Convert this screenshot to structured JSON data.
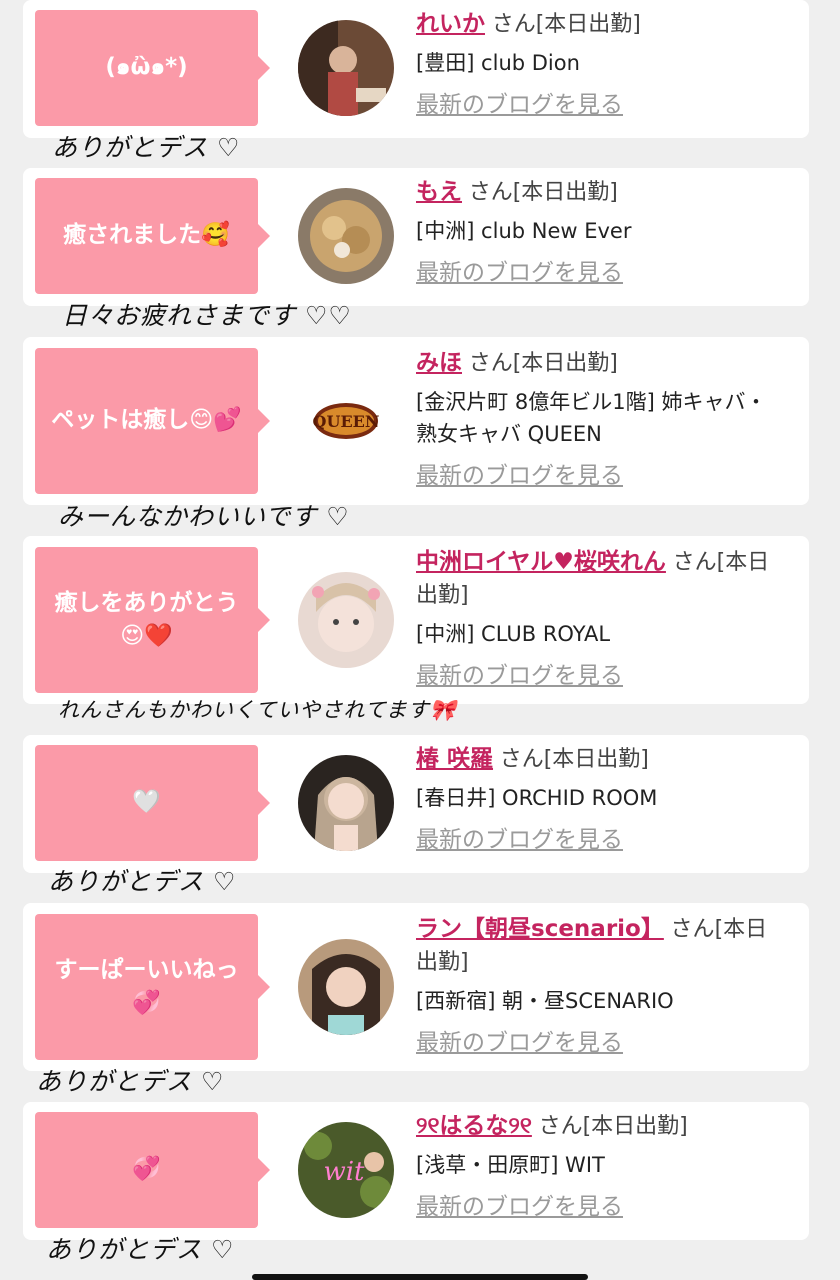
{
  "blog_link_label": "最新のブログを見る",
  "honorific": "さん",
  "entries": [
    {
      "bubble": "(๑ὢ๑*)",
      "name": "れいか",
      "status": "[本日出勤]",
      "shop": "[豊田] club Dion",
      "handwritten": "ありがとデス ♡",
      "avatar": "photo-avatar"
    },
    {
      "bubble": "癒されました🥰",
      "name": "もえ",
      "status": "[本日出勤]",
      "shop": "[中洲] club New Ever",
      "handwritten": "日々お疲れさまです ♡♡",
      "avatar": "photo-avatar"
    },
    {
      "bubble": "ペットは癒し😊💕",
      "name": "みほ",
      "status": "[本日出勤]",
      "shop": "[金沢片町 8億年ビル1階] 姉キャバ・熟女キャバ QUEEN",
      "handwritten": "みーんなかわいいです ♡",
      "avatar": "queen-logo"
    },
    {
      "bubble": "癒しをありがとう😍❤️",
      "name": "中洲ロイヤル♥桜咲れん",
      "status": "[本日出勤]",
      "shop": "[中洲] CLUB ROYAL",
      "handwritten": "れんさんもかわいくていやされてます🎀",
      "avatar": "photo-avatar"
    },
    {
      "bubble": "🤍",
      "name": "椿 咲羅",
      "status": "[本日出勤]",
      "shop": "[春日井] ORCHID ROOM",
      "handwritten": "ありがとデス ♡",
      "avatar": "photo-avatar"
    },
    {
      "bubble": "すーぱーいいねっ💞",
      "name": "ラン【朝昼scenario】",
      "status": "[本日出勤]",
      "shop": "[西新宿] 朝・昼SCENARIO",
      "handwritten": "ありがとデス ♡",
      "avatar": "photo-avatar"
    },
    {
      "bubble": "💞",
      "name": "୨୧はるな୨୧",
      "status": "[本日出勤]",
      "shop": "[浅草・田原町] WIT",
      "handwritten": "ありがとデス ♡",
      "avatar": "photo-avatar"
    }
  ],
  "colors": {
    "bubble": "#fb9aa8",
    "name": "#c4245f",
    "link": "#9a9a9a",
    "background": "#efefef"
  }
}
